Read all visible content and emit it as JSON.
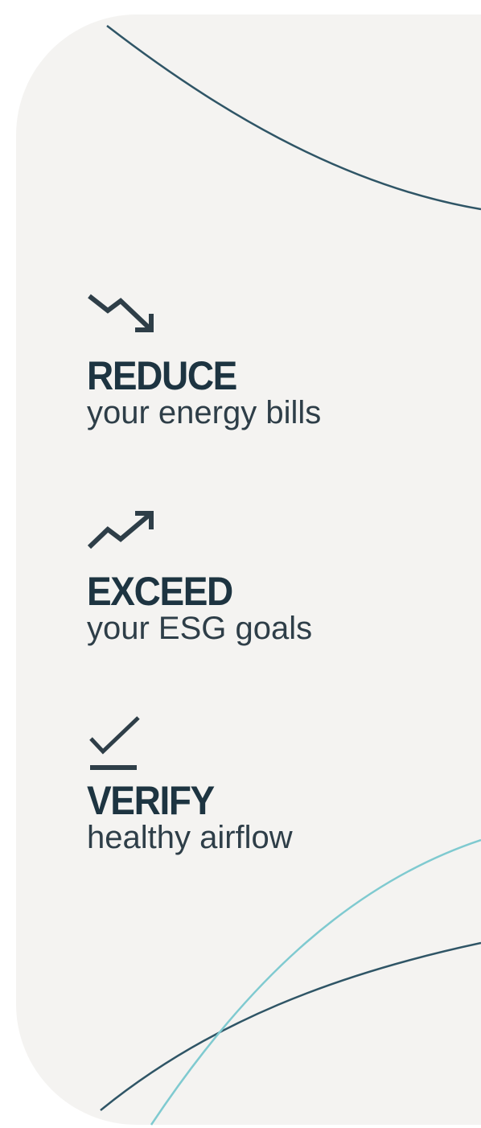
{
  "features": [
    {
      "icon": "trending-down-icon",
      "heading": "REDUCE",
      "subtitle": "your energy bills"
    },
    {
      "icon": "trending-up-icon",
      "heading": "EXCEED",
      "subtitle": "your ESG goals"
    },
    {
      "icon": "checkmark-underline-icon",
      "heading": "VERIFY",
      "subtitle": "healthy airflow"
    }
  ],
  "colors": {
    "background": "#f4f3f1",
    "heading": "#1d3441",
    "text": "#2e3e48",
    "curve_dark": "#2f5566",
    "curve_teal": "#7fcad0"
  }
}
